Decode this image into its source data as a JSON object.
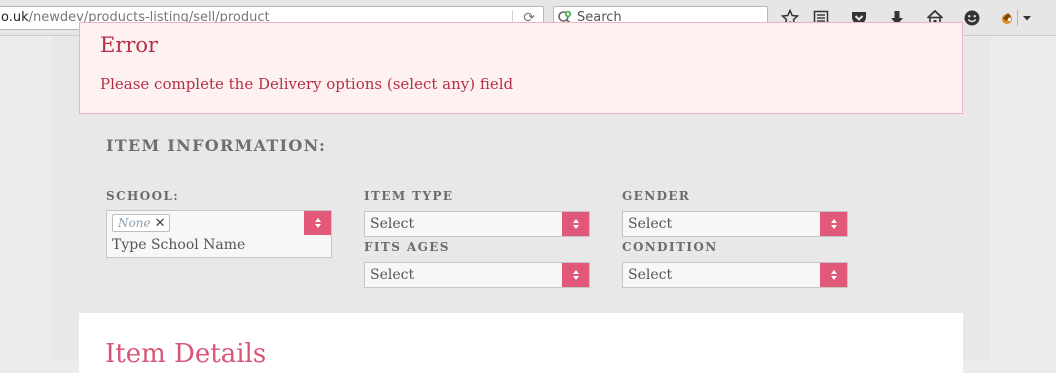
{
  "browser": {
    "url_host": "o.uk",
    "url_path": "/newdev/products-listing/sell/product",
    "search_placeholder": "Search"
  },
  "error": {
    "title": "Error",
    "message": "Please complete the Delivery options (select any) field"
  },
  "item_info": {
    "title": "ITEM INFORMATION:",
    "school": {
      "label": "SCHOOL:",
      "chip": "None",
      "placeholder": "Type School Name"
    },
    "item_type": {
      "label": "ITEM TYPE",
      "value": "Select"
    },
    "gender": {
      "label": "GENDER",
      "value": "Select"
    },
    "fits_ages": {
      "label": "FITS AGES",
      "value": "Select"
    },
    "condition": {
      "label": "CONDITION",
      "value": "Select"
    }
  },
  "details": {
    "title": "Item Details"
  },
  "colors": {
    "accent": "#e25879",
    "error_text": "#b53045",
    "error_bg": "#fdf1f2"
  }
}
